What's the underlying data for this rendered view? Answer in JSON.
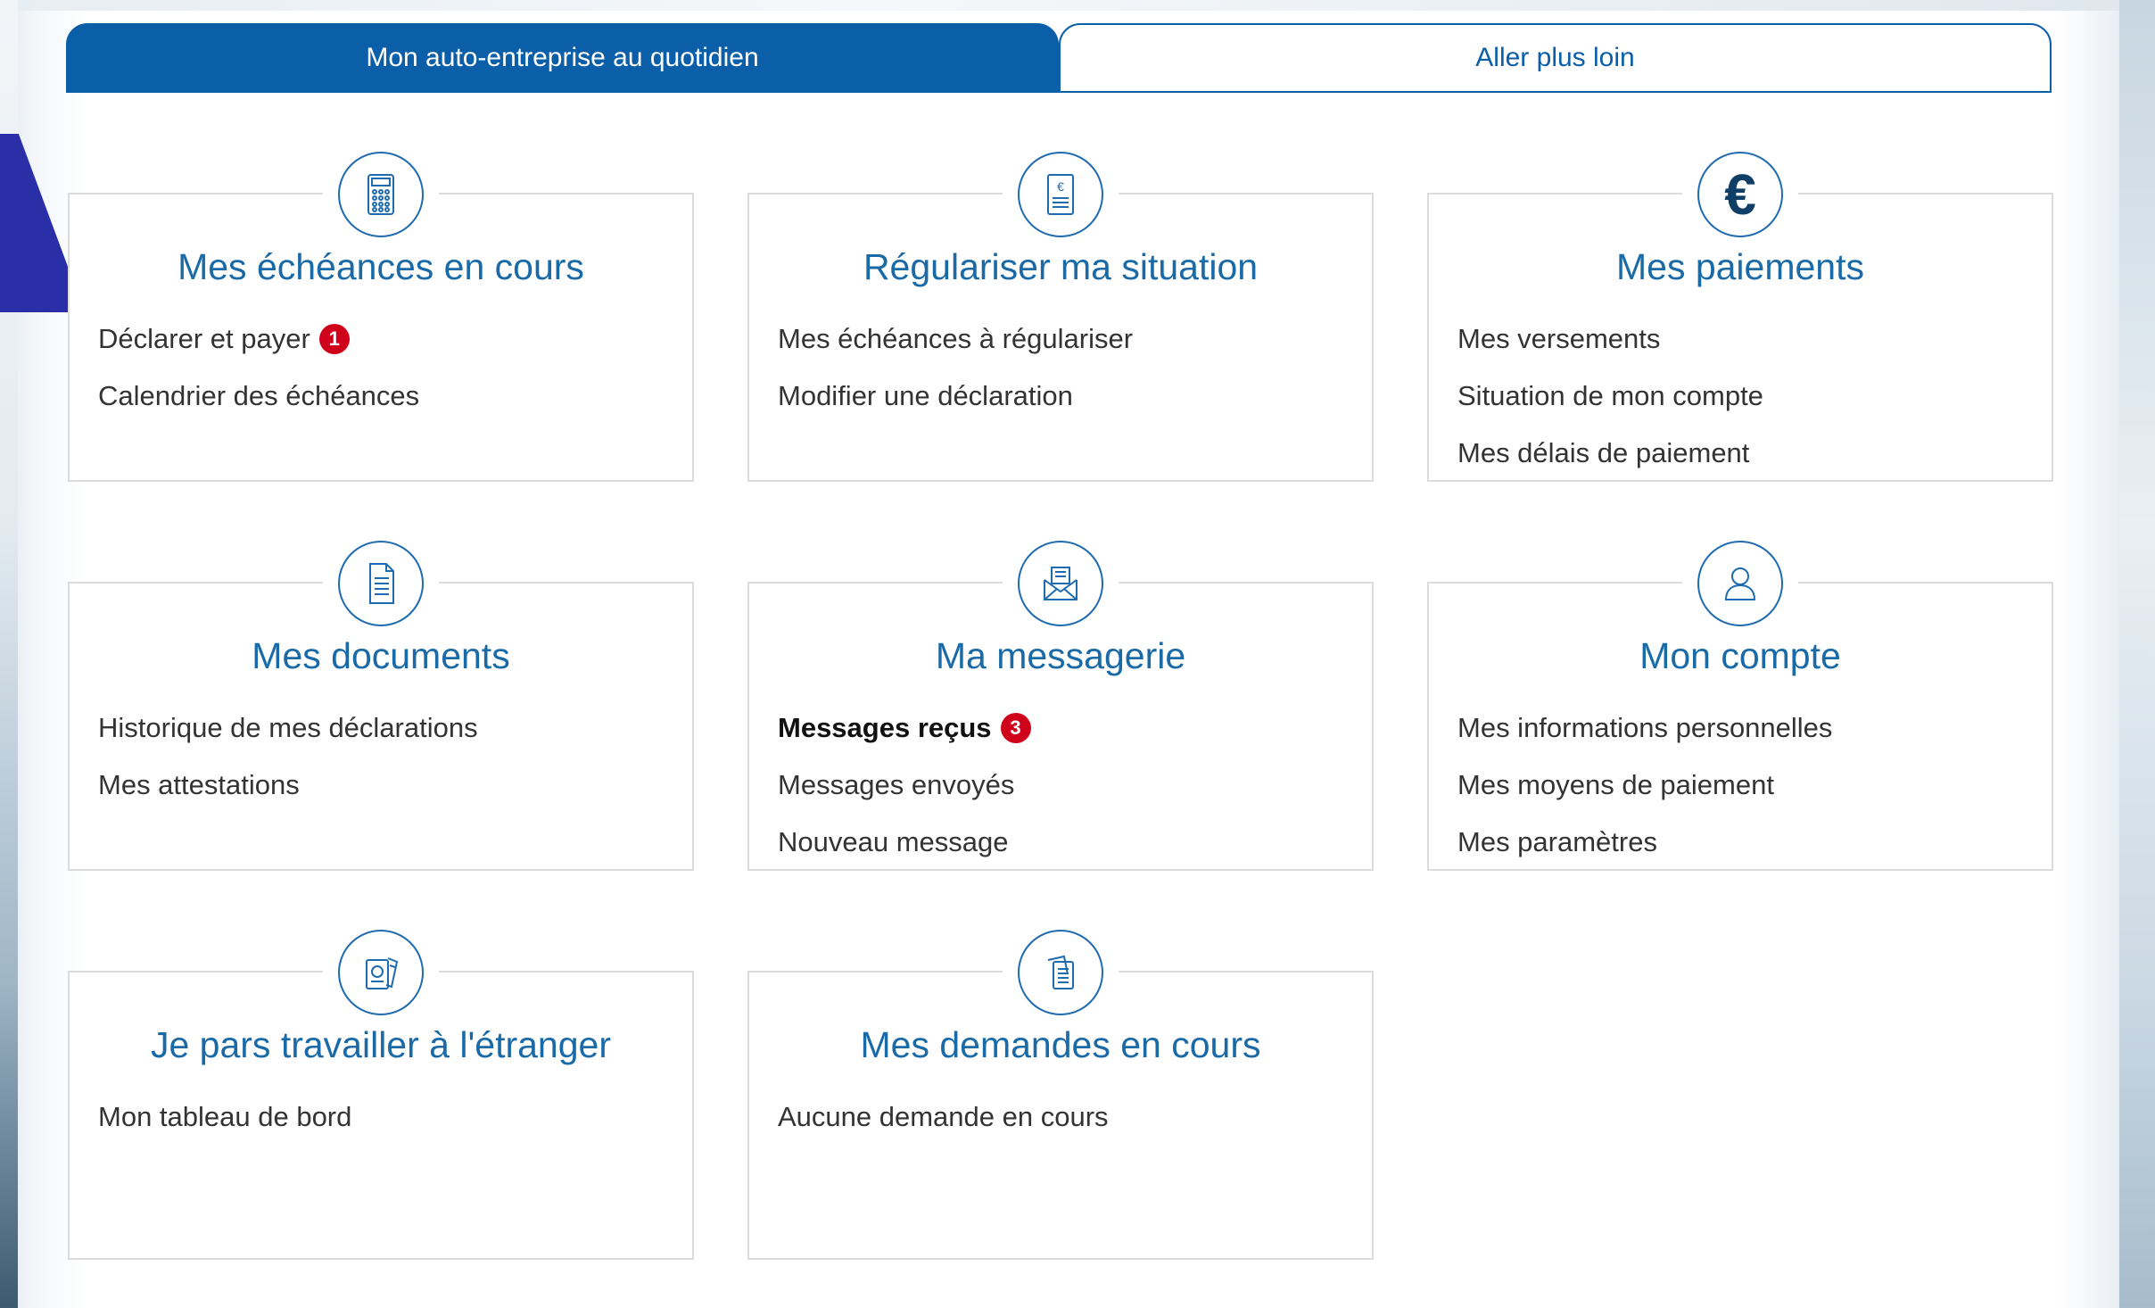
{
  "tabs": [
    {
      "label": "Mon auto-entreprise au quotidien",
      "active": true
    },
    {
      "label": "Aller plus loin",
      "active": false
    }
  ],
  "cards": [
    {
      "title": "Mes échéances en cours",
      "icon": "calculator-icon",
      "links": [
        {
          "label": "Déclarer et payer",
          "badge": "1"
        },
        {
          "label": "Calendrier des échéances"
        }
      ]
    },
    {
      "title": "Régulariser ma situation",
      "icon": "euro-document-icon",
      "links": [
        {
          "label": "Mes échéances à régulariser"
        },
        {
          "label": "Modifier une déclaration"
        }
      ]
    },
    {
      "title": "Mes paiements",
      "icon": "euro-icon",
      "links": [
        {
          "label": "Mes versements"
        },
        {
          "label": "Situation de mon compte"
        },
        {
          "label": "Mes délais de paiement"
        }
      ]
    },
    {
      "title": "Mes documents",
      "icon": "document-icon",
      "links": [
        {
          "label": "Historique de mes déclarations"
        },
        {
          "label": "Mes attestations"
        }
      ]
    },
    {
      "title": "Ma messagerie",
      "icon": "envelope-icon",
      "links": [
        {
          "label": "Messages reçus",
          "badge": "3",
          "bold": true
        },
        {
          "label": "Messages envoyés"
        },
        {
          "label": "Nouveau message"
        }
      ]
    },
    {
      "title": "Mon compte",
      "icon": "user-icon",
      "links": [
        {
          "label": "Mes informations personnelles"
        },
        {
          "label": "Mes moyens de paiement"
        },
        {
          "label": "Mes paramètres"
        }
      ]
    },
    {
      "title": "Je pars travailler à l'étranger",
      "icon": "passport-icon",
      "links": [
        {
          "label": "Mon tableau de bord"
        }
      ]
    },
    {
      "title": "Mes demandes en cours",
      "icon": "files-icon",
      "links": [
        {
          "label": "Aucune demande en cours"
        }
      ]
    }
  ],
  "colors": {
    "primary": "#0b5ea8",
    "title": "#1a6aa8",
    "badge": "#d0021b",
    "pointer": "#2a2fa8"
  }
}
